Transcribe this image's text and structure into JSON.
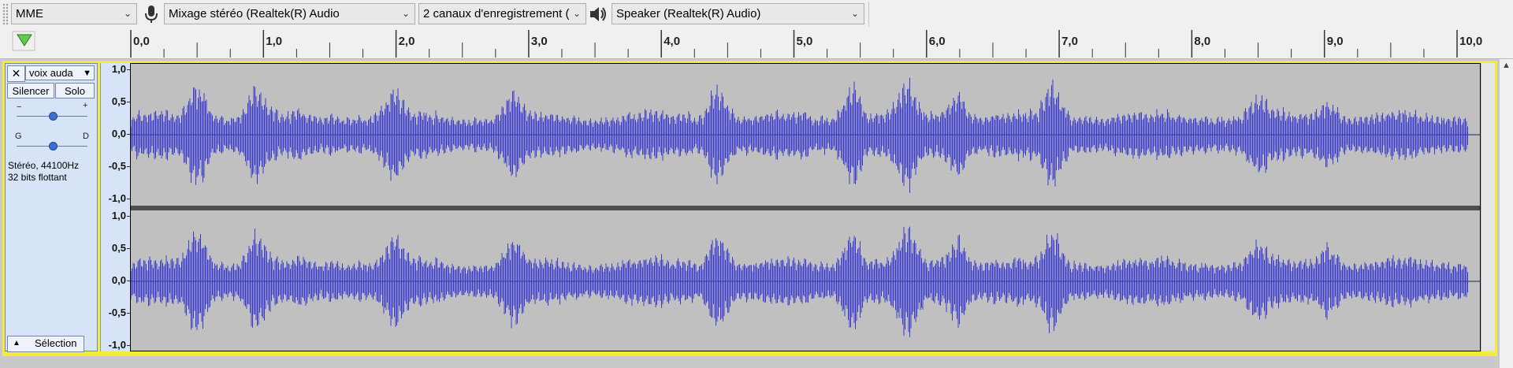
{
  "toolbar": {
    "host": "MME",
    "recording_device": "Mixage stéréo (Realtek(R) Audio",
    "recording_channels": "2 canaux d'enregistrement (",
    "playback_device": "Speaker (Realtek(R) Audio)",
    "icons": [
      "microphone-icon",
      "speaker-icon"
    ]
  },
  "timeline": {
    "labels": [
      "0,0",
      "1,0",
      "2,0",
      "3,0",
      "4,0",
      "5,0",
      "6,0",
      "7,0",
      "8,0",
      "9,0",
      "10,0"
    ],
    "start_seconds": 0.0,
    "end_seconds": 10.15,
    "play_head_icon": "play-head-triangle-icon"
  },
  "track": {
    "name": "voix auda",
    "mute_label": "Silencer",
    "solo_label": "Solo",
    "gain_minus": "−",
    "gain_plus": "+",
    "pan_left": "G",
    "pan_right": "D",
    "format_line1": "Stéréo, 44100Hz",
    "format_line2": "32 bits flottant",
    "select_label": "Sélection",
    "amplitude_labels": [
      "1,0",
      "0,5",
      "0,0",
      "-0,5",
      "-1,0"
    ]
  },
  "colors": {
    "waveform": "#3a3ad0",
    "waveform_bg": "#c0c0c0",
    "selected_track_border": "#f3ec3c",
    "control_panel": "#d7e3f6"
  }
}
